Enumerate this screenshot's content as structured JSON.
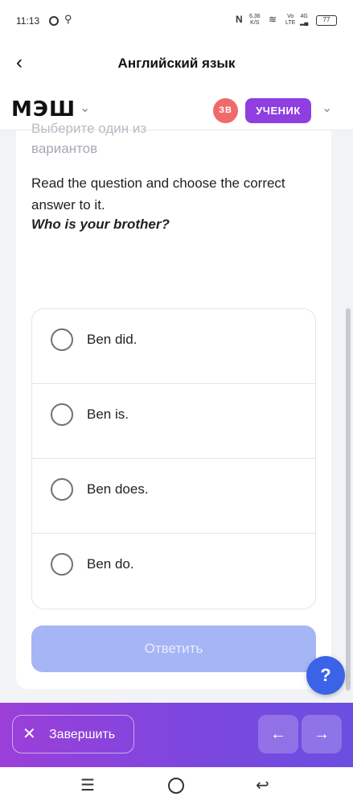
{
  "status_bar": {
    "time": "11:13",
    "circle_icon": "circle-icon",
    "search_icon": "search-icon",
    "nfc": "N",
    "speed_value": "6,36",
    "speed_unit": "K/S",
    "wifi_icon": "wifi-icon",
    "sim1_top": "Vo",
    "sim1_bottom": "LTE",
    "sim2_top": "4G",
    "battery": "77"
  },
  "title_bar": {
    "back_icon": "‹",
    "title": "Английский язык"
  },
  "app_header": {
    "logo": "МЭШ",
    "avatar_initials": "ЗВ",
    "role": "УЧЕНИК",
    "chevron": "⌄"
  },
  "task": {
    "cut_text": "Выберите один из",
    "instruction_tail": "вариантов",
    "question": "Read the question and choose the correct answer to it.",
    "question_highlight": "Who is your brother?",
    "options": [
      {
        "label": "Ben did.",
        "selected": false
      },
      {
        "label": "Ben is.",
        "selected": false
      },
      {
        "label": "Ben does.",
        "selected": false
      },
      {
        "label": "Ben do.",
        "selected": false
      }
    ],
    "submit_label": "Ответить"
  },
  "help": {
    "label": "?"
  },
  "action_bar": {
    "finish_icon": "✕",
    "finish_label": "Завершить",
    "prev_icon": "←",
    "next_icon": "→"
  },
  "system_nav": {
    "menu_icon": "☰",
    "back_icon": "↩"
  },
  "colors": {
    "accent": "#8f3fe0",
    "avatar": "#ef6b6b",
    "submit_disabled": "#a6b5f5",
    "help": "#3b63e8"
  }
}
